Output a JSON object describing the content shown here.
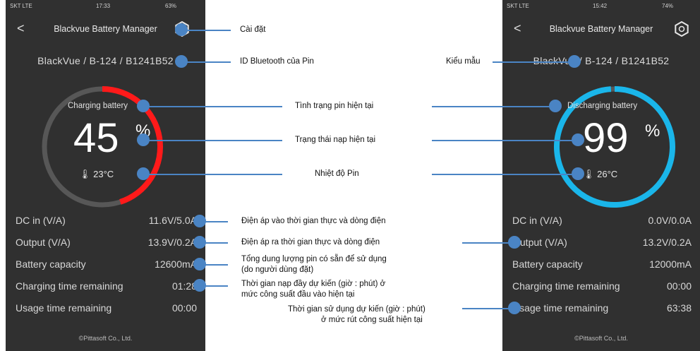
{
  "left_phone": {
    "status": {
      "carrier": "SKT LTE",
      "time": "17:33",
      "battery": "63%"
    },
    "title": "Blackvue Battery Manager",
    "model": "BlackVue / B-124  / B1241B52",
    "state_label": "Charging battery",
    "percent": "45",
    "percent_sign": "%",
    "percent_value": 45,
    "temperature": "23°C",
    "ring_color": "#ff1a1a",
    "rows": [
      {
        "label": "DC in (V/A)",
        "value": "11.6V/5.0A"
      },
      {
        "label": "Output (V/A)",
        "value": "13.9V/0.2A"
      },
      {
        "label": "Battery capacity",
        "value": "12600mA"
      },
      {
        "label": "Charging time remaining",
        "value": "01:28"
      },
      {
        "label": "Usage time remaining",
        "value": "00:00"
      }
    ],
    "footer": "©Pittasoft Co., Ltd."
  },
  "right_phone": {
    "status": {
      "carrier": "SKT LTE",
      "time": "15:42",
      "battery": "74%"
    },
    "title": "Blackvue Battery Manager",
    "model": "BlackVue / B-124  / B1241B52",
    "state_label": "Discharging battery",
    "percent": "99",
    "percent_sign": "%",
    "percent_value": 99,
    "temperature": "26°C",
    "ring_color": "#1ab6ea",
    "rows": [
      {
        "label": "DC in (V/A)",
        "value": "0.0V/0.0A"
      },
      {
        "label": "Output (V/A)",
        "value": "13.2V/0.2A"
      },
      {
        "label": "Battery capacity",
        "value": "12000mA"
      },
      {
        "label": "Charging time remaining",
        "value": "00:00"
      },
      {
        "label": "Usage time remaining",
        "value": "63:38"
      }
    ],
    "footer": "©Pittasoft Co., Ltd."
  },
  "annotations": {
    "settings": "Cài đặt",
    "bluetooth_id": "ID Bluetooth của Pin",
    "model": "Kiểu mẫu",
    "battery_status": "Tình trạng pin hiện tại",
    "charge_state": "Trạng thái nạp hiện tại",
    "temperature": "Nhiệt độ Pin",
    "input": "Điện áp vào thời gian thực và dòng điện",
    "output": "Điện áp ra thời gian thực và dòng điện",
    "capacity_1": "Tổng dung lượng pin có sẵn để sử dụng",
    "capacity_2": "(do người dùng đặt)",
    "charge_time_1": "Thời gian nạp đầy dự kiến (giờ : phút) ở",
    "charge_time_2": "mức công suất đầu vào hiện tại",
    "usage_time_1": "Thời gian sử dụng dự kiến (giờ : phút)",
    "usage_time_2": "ở mức rút công suất hiện tại"
  },
  "colors": {
    "callout": "#4a84c4",
    "phone_bg": "#303030"
  }
}
